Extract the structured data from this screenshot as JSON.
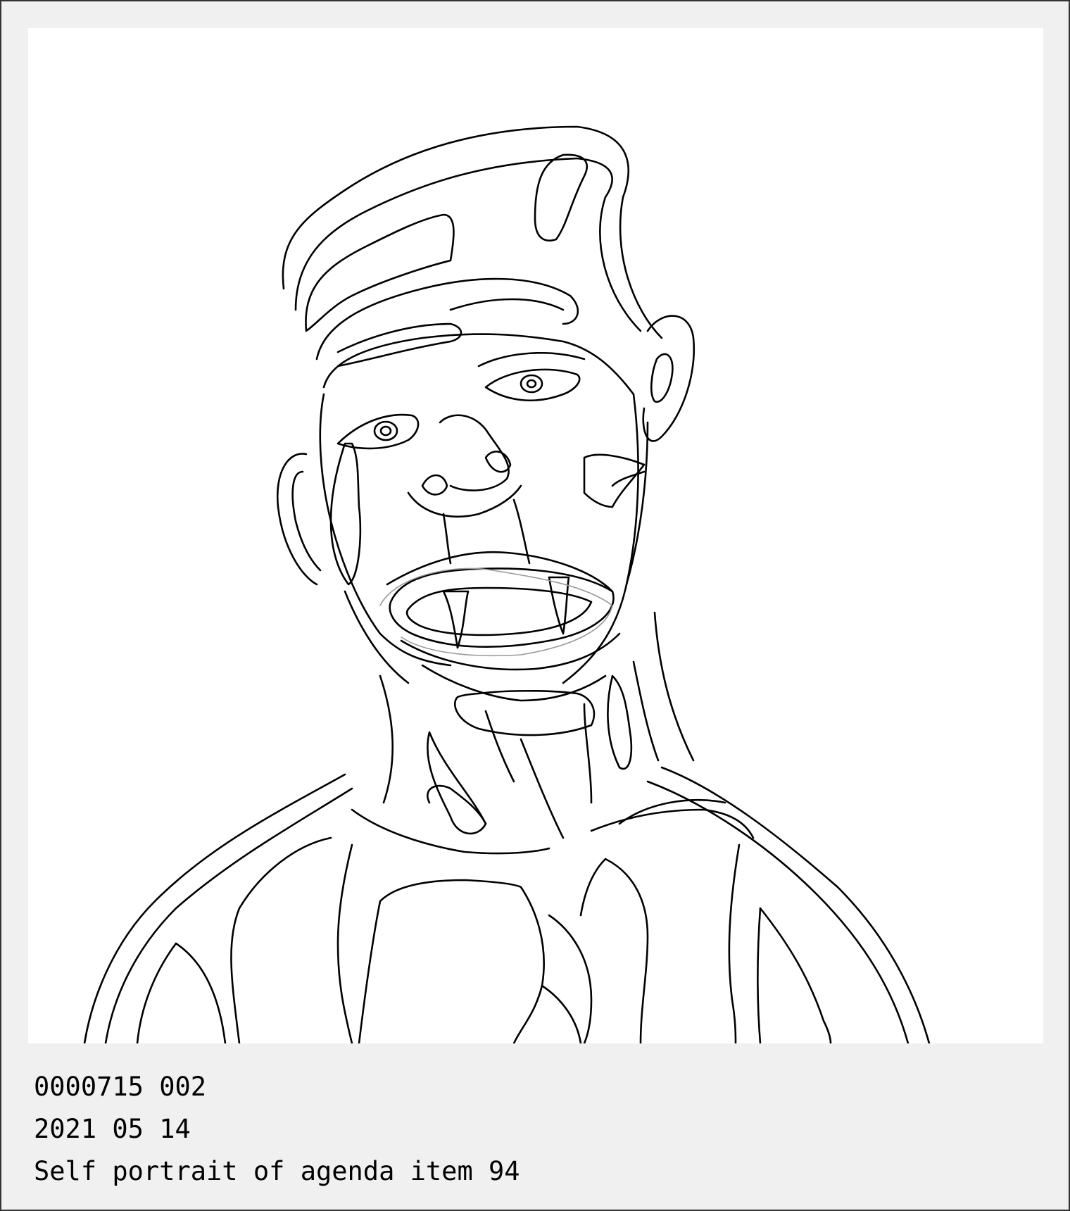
{
  "caption": {
    "id_line": "0000715 002",
    "date_line": "2021 05 14",
    "title_line": "Self portrait of agenda item 94"
  },
  "colors": {
    "background": "#f0f0f0",
    "canvas": "#ffffff",
    "ink": "#000000",
    "sketch": "#999999"
  }
}
